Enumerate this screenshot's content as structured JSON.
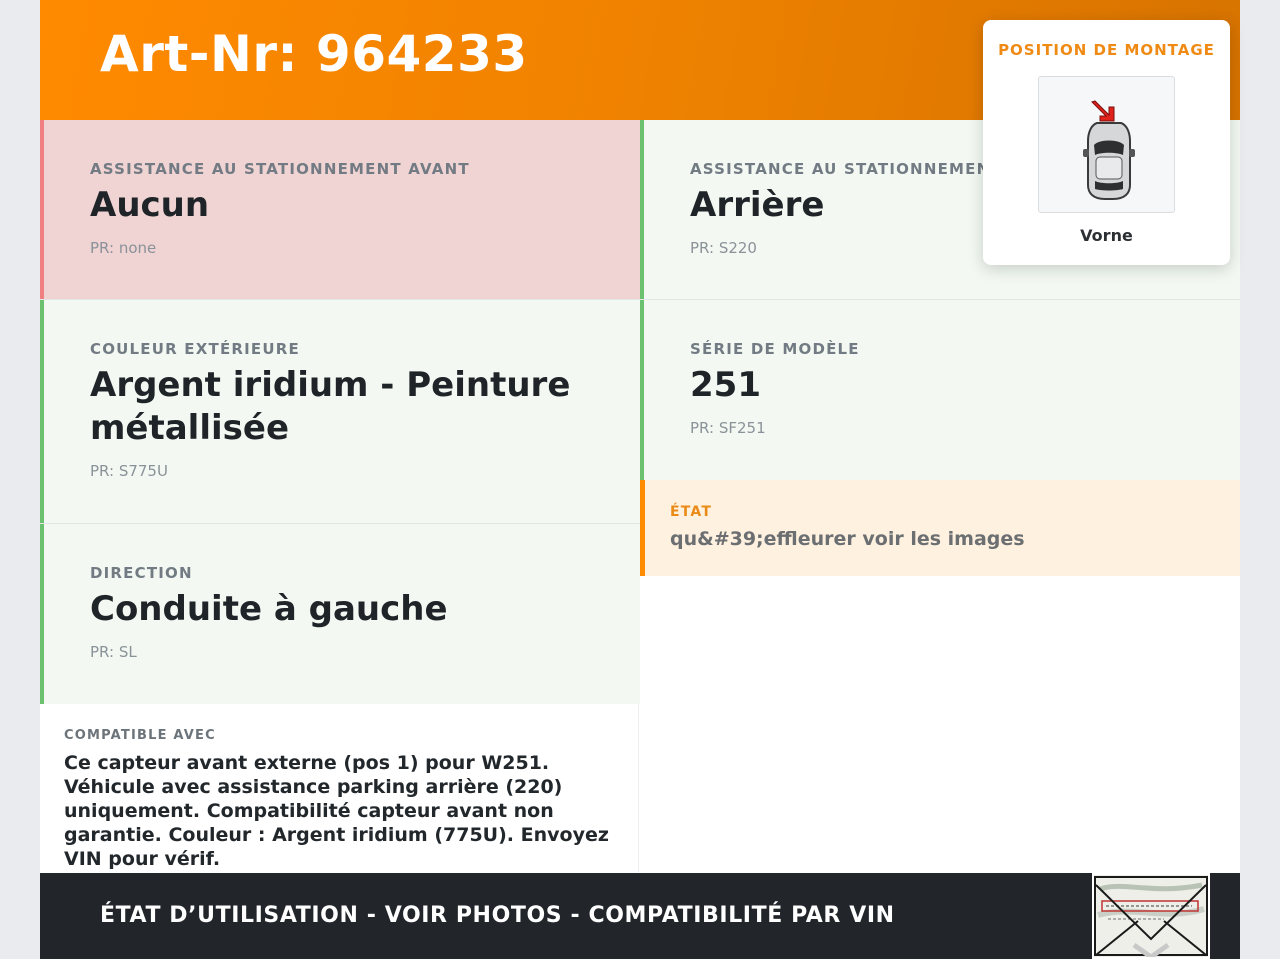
{
  "header": {
    "art_title": "Art-Nr: 964233"
  },
  "tiles": [
    {
      "label": "ASSISTANCE AU STATIONNEMENT AVANT",
      "value": "Aucun",
      "pr": "PR: none",
      "status": "red"
    },
    {
      "label": "ASSISTANCE AU STATIONNEMENT",
      "value": "Arrière",
      "pr": "PR: S220",
      "status": "green"
    },
    {
      "label": "COULEUR EXTÉRIEURE",
      "value": "Argent iridium - Peinture métallisée",
      "pr": "PR: S775U",
      "status": "green"
    },
    {
      "label": "SÉRIE DE MODÈLE",
      "value": "251",
      "pr": "PR: SF251",
      "status": "green"
    },
    {
      "label": "DIRECTION",
      "value": "Conduite à gauche",
      "pr": "PR: SL",
      "status": "green"
    }
  ],
  "etat": {
    "label": "ÉTAT",
    "value": "qu&#39;effleurer voir les images"
  },
  "compat": {
    "label": "COMPATIBLE AVEC",
    "text": "Ce capteur avant externe (pos 1) pour W251. Véhicule avec assistance parking arrière (220) uniquement. Compatibilité capteur avant non garantie. Couleur : Argent iridium (775U). Envoyez VIN pour vérif."
  },
  "footer": {
    "text": "ÉTAT D’UTILISATION - VOIR PHOTOS - COMPATIBILITÉ PAR VIN"
  },
  "popup": {
    "label": "POSITION DE MONTAGE",
    "caption": "Vorne"
  },
  "colors": {
    "accent": "#ff8a00",
    "green": "#6cc16e",
    "red": "#f07f82",
    "dark": "#22262b"
  }
}
